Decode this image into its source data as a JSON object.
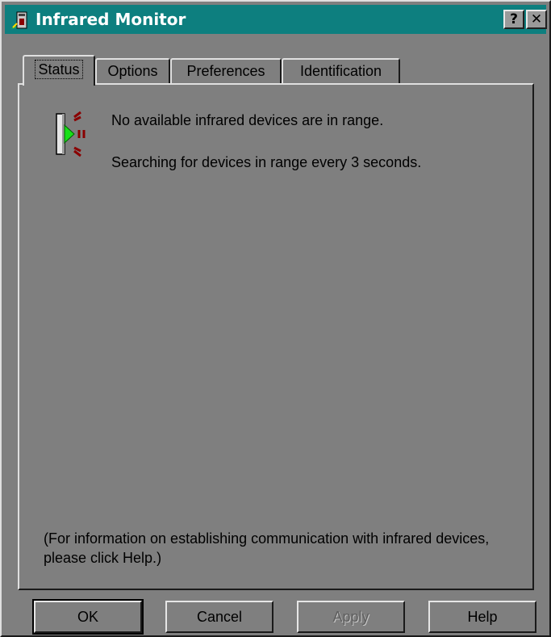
{
  "window": {
    "title": "Infrared Monitor",
    "title_bar_color": "#0d7f7f",
    "icon": "infrared-monitor-app-icon",
    "buttons": {
      "help_label": "?",
      "close_label": "✕"
    }
  },
  "tabs": [
    {
      "label": "Status",
      "active": true
    },
    {
      "label": "Options",
      "active": false
    },
    {
      "label": "Preferences",
      "active": false
    },
    {
      "label": "Identification",
      "active": false
    }
  ],
  "status": {
    "icon": "infrared-port-icon",
    "line1": "No available infrared devices are in range.",
    "line2": "Searching for devices in range every 3 seconds.",
    "footer": "(For information on establishing communication with infrared devices, please click Help.)"
  },
  "buttons": {
    "ok": "OK",
    "cancel": "Cancel",
    "apply": "Apply",
    "help": "Help",
    "apply_enabled": false
  }
}
